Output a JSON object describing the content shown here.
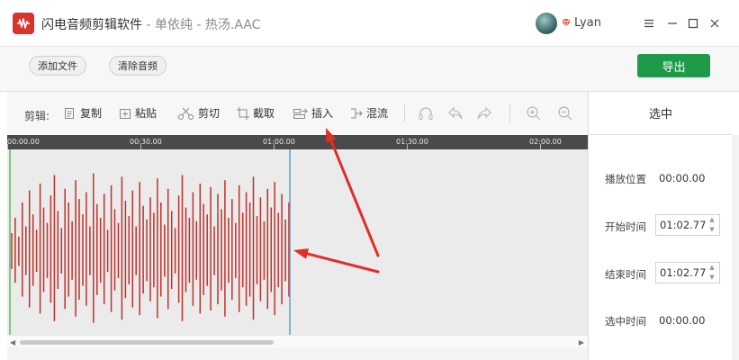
{
  "window": {
    "app_name": "闪电音频剪辑软件",
    "separator": " - ",
    "file_info": "单依纯 - 热汤.AAC",
    "username": "Lyan",
    "controls": {
      "menu": "≡",
      "minimize": "—",
      "maximize": "☐",
      "close": "✕"
    }
  },
  "toolbar": {
    "add_file": "添加文件",
    "clear_audio": "清除音频",
    "export": "导出"
  },
  "edit_bar": {
    "label": "剪辑:",
    "tools": {
      "copy": "复制",
      "paste": "粘贴",
      "cut": "剪切",
      "crop": "截取",
      "insert": "插入",
      "mix": "混流"
    }
  },
  "ruler": {
    "labels": [
      "00:00.00",
      "00:30.00",
      "01:00.00",
      "01:30.00",
      "02:00.00"
    ]
  },
  "panel": {
    "title": "选中",
    "play_position_label": "播放位置",
    "play_position_value": "00:00.00",
    "start_time_label": "开始时间",
    "start_time_value": "01:02.77",
    "end_time_label": "结束时间",
    "end_time_value": "01:02.77",
    "selected_time_label": "选中时间",
    "selected_time_value": "00:00.00"
  },
  "colors": {
    "waveform": "#c0302a",
    "playhead": "#3a9bd5",
    "start_marker": "#57c257",
    "export_button": "#1f9a48",
    "annotation_arrow": "#e12e26"
  },
  "icons": {
    "logo": "audio-wave-logo-icon",
    "vip": "diamond-vip-icon"
  }
}
